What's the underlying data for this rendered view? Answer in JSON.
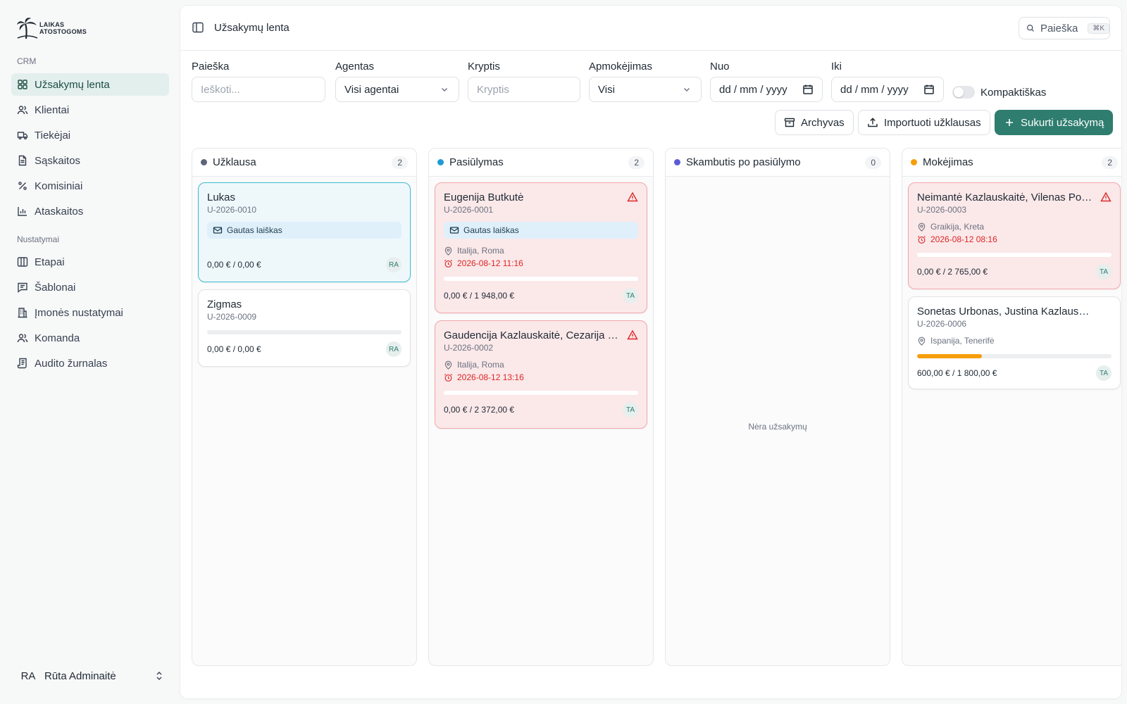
{
  "brand": {
    "logo_line1": "LAIKAS",
    "logo_line2": "ATOSTOGOMS"
  },
  "sidebar": {
    "section_crm": "CRM",
    "crm_items": [
      {
        "label": "Užsakymų lenta",
        "icon": "grid-icon"
      },
      {
        "label": "Klientai",
        "icon": "users-icon"
      },
      {
        "label": "Tiekėjai",
        "icon": "truck-icon"
      },
      {
        "label": "Sąskaitos",
        "icon": "document-icon"
      },
      {
        "label": "Komisiniai",
        "icon": "percent-icon"
      },
      {
        "label": "Ataskaitos",
        "icon": "bar-chart-icon"
      }
    ],
    "section_settings": "Nustatymai",
    "settings_items": [
      {
        "label": "Etapai",
        "icon": "columns-icon"
      },
      {
        "label": "Šablonai",
        "icon": "message-icon"
      },
      {
        "label": "Įmonės nustatymai",
        "icon": "building-icon"
      },
      {
        "label": "Komanda",
        "icon": "users-icon"
      },
      {
        "label": "Audito žurnalas",
        "icon": "log-icon"
      }
    ],
    "user": {
      "initials": "RA",
      "name": "Rūta Adminaitė"
    }
  },
  "header": {
    "title": "Užsakymų lenta",
    "search_label": "Paieška",
    "search_shortcut": "⌘K"
  },
  "filters": {
    "search_label": "Paieška",
    "search_placeholder": "Ieškoti...",
    "agent_label": "Agentas",
    "agent_value": "Visi agentai",
    "direction_label": "Kryptis",
    "direction_placeholder": "Kryptis",
    "payment_label": "Apmokėjimas",
    "payment_value": "Visi",
    "from_label": "Nuo",
    "from_value": "dd / mm / yyyy",
    "to_label": "Iki",
    "to_value": "dd / mm / yyyy",
    "compact_label": "Kompaktiškas",
    "compact_on": false
  },
  "actions": {
    "archive": "Archyvas",
    "import": "Importuoti užklausas",
    "create": "Sukurti užsakymą"
  },
  "colors": {
    "accent": "#2e7d6e",
    "stage_inquiry": "#5b6478",
    "stage_offer": "#1e9bd7",
    "stage_call": "#5b5bd6",
    "stage_payment": "#f59e0b",
    "overdue": "#dc2626"
  },
  "board": {
    "empty_text": "Nėra užsakymų",
    "columns": [
      {
        "title": "Užklausa",
        "count": "2",
        "cards": [
          {
            "name": "Lukas",
            "code": "U-2026-0010",
            "tag": "Gautas laiškas",
            "amount": "0,00 € / 0,00 €",
            "agent": "RA",
            "selected": true
          },
          {
            "name": "Zigmas",
            "code": "U-2026-0009",
            "amount": "0,00 € / 0,00 €",
            "agent": "RA",
            "progress": 0
          }
        ]
      },
      {
        "title": "Pasiūlymas",
        "count": "2",
        "cards": [
          {
            "name": "Eugenija Butkutė",
            "code": "U-2026-0001",
            "tag": "Gautas laiškas",
            "location": "Italija, Roma",
            "deadline": "2026-08-12 11:16",
            "amount": "0,00 € / 1 948,00 €",
            "agent": "TA",
            "progress": 0,
            "warning": true
          },
          {
            "name": "Gaudencija Kazlauskaitė, Cezarija Pet…",
            "code": "U-2026-0002",
            "location": "Italija, Roma",
            "deadline": "2026-08-12 13:16",
            "amount": "0,00 € / 2 372,00 €",
            "agent": "TA",
            "progress": 0,
            "warning": true
          }
        ]
      },
      {
        "title": "Skambutis po pasiūlymo",
        "count": "0",
        "cards": []
      },
      {
        "title": "Mokėjimas",
        "count": "2",
        "cards": [
          {
            "name": "Neimantė Kazlauskaitė, Vilenas Pocius",
            "code": "U-2026-0003",
            "location": "Graikija, Kreta",
            "deadline": "2026-08-12 08:16",
            "amount": "0,00 € / 2 765,00 €",
            "agent": "TA",
            "progress": 0,
            "warning": true
          },
          {
            "name": "Sonetas Urbonas, Justina Kazlauskienė",
            "code": "U-2026-0006",
            "location": "Ispanija, Tenerifė",
            "amount": "600,00 € / 1 800,00 €",
            "agent": "TA",
            "progress": 0.333
          }
        ]
      }
    ]
  }
}
